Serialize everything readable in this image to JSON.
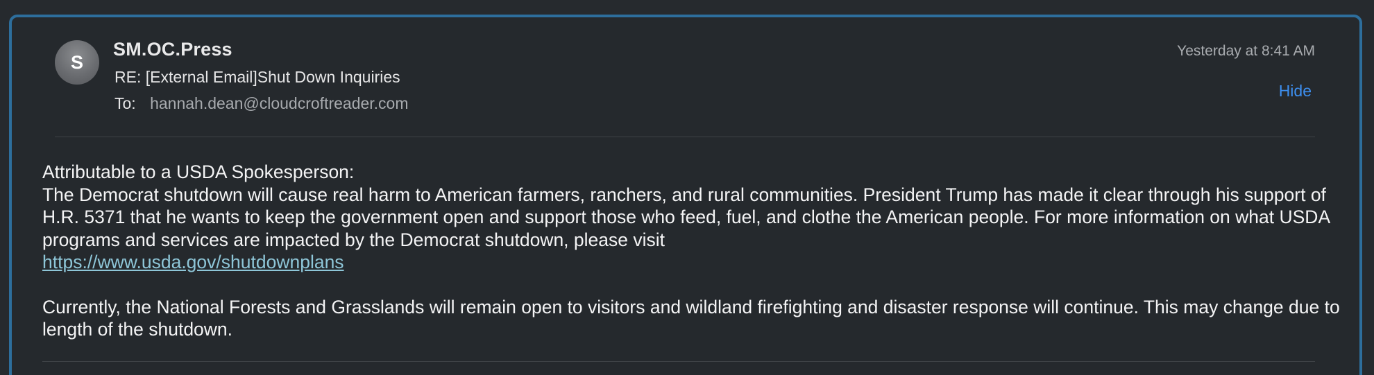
{
  "email": {
    "avatar_initial": "S",
    "sender": "SM.OC.Press",
    "subject": "RE: [External Email]Shut Down Inquiries",
    "to_label": "To:",
    "to_address": "hannah.dean@cloudcroftreader.com",
    "timestamp": "Yesterday at 8:41 AM",
    "hide_label": "Hide"
  },
  "body": {
    "line1": "Attributable to a USDA Spokesperson:",
    "paragraph1": "The Democrat shutdown will cause real harm to American farmers, ranchers, and rural communities. President Trump has made it clear through his support of H.R. 5371 that he wants to keep the government open and support those who feed, fuel, and clothe the American people. For more information on what USDA programs and services are impacted by the Democrat shutdown, please visit",
    "link": "https://www.usda.gov/shutdownplans",
    "paragraph2": "Currently, the National Forests and Grasslands will remain open to visitors and wildland firefighting and disaster response will continue. This may change due to length of the shutdown."
  },
  "colors": {
    "background": "#25292d",
    "frame_border": "#2d6e9c",
    "link": "#8ec6d8",
    "hide_button": "#3d8ff0"
  }
}
